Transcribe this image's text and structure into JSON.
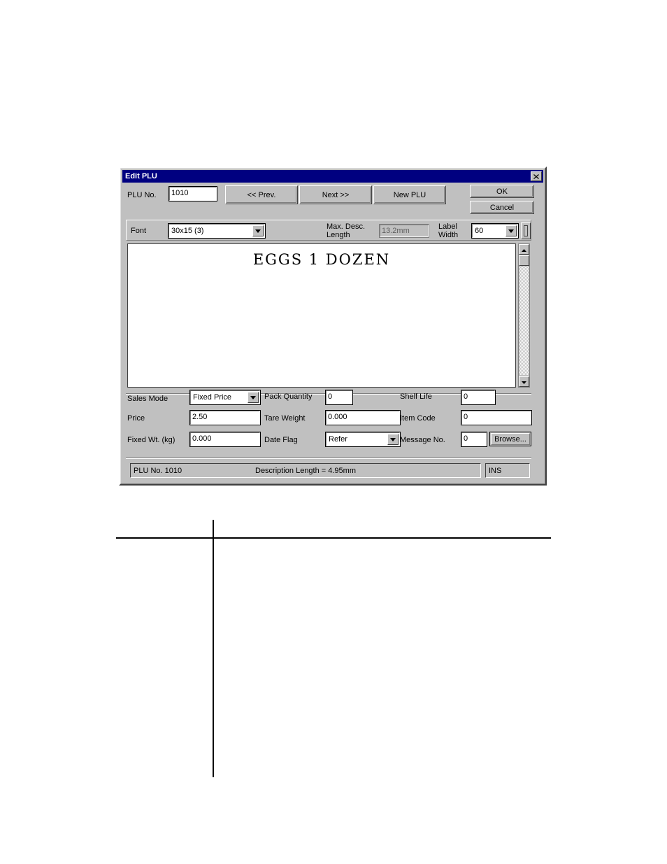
{
  "window": {
    "title": "Edit PLU",
    "close_icon": "close-icon"
  },
  "header": {
    "plu_no_label": "PLU No.",
    "plu_no_value": "1010",
    "prev_button": "<< Prev.",
    "next_button": "Next >>",
    "new_plu_button": "New PLU",
    "ok_button": "OK",
    "cancel_button": "Cancel"
  },
  "font_row": {
    "font_label": "Font",
    "font_value": "30x15 (3)",
    "max_desc_length_label": "Max. Desc.\nLength",
    "max_desc_length_value": "13.2mm",
    "label_width_label": "Label\nWidth",
    "label_width_value": "60",
    "preview_button_icon": "label-preview-icon"
  },
  "description": {
    "text": "EGGS 1 DOZEN",
    "scroll_up_icon": "scroll-up-arrow-icon",
    "scroll_down_icon": "scroll-down-arrow-icon"
  },
  "fields": {
    "sales_mode_label": "Sales Mode",
    "sales_mode_value": "Fixed Price",
    "price_label": "Price",
    "price_value": "2.50",
    "fixed_wt_label": "Fixed Wt. (kg)",
    "fixed_wt_value": "0.000",
    "pack_quantity_label": "Pack Quantity",
    "pack_quantity_value": "0",
    "tare_weight_label": "Tare Weight",
    "tare_weight_value": "0.000",
    "date_flag_label": "Date Flag",
    "date_flag_value": "Refer",
    "shelf_life_label": "Shelf Life",
    "shelf_life_value": "0",
    "item_code_label": "Item Code",
    "item_code_value": "0",
    "message_no_label": "Message No.",
    "message_no_value": "0",
    "browse_button": "Browse..."
  },
  "statusbar": {
    "left_text": "PLU No. 1010",
    "center_text": "Description Length = 4.95mm",
    "ins_text": "INS"
  },
  "colors": {
    "titlebar": "#000080",
    "face": "#c0c0c0",
    "shadow": "#808080",
    "dark": "#404040"
  }
}
